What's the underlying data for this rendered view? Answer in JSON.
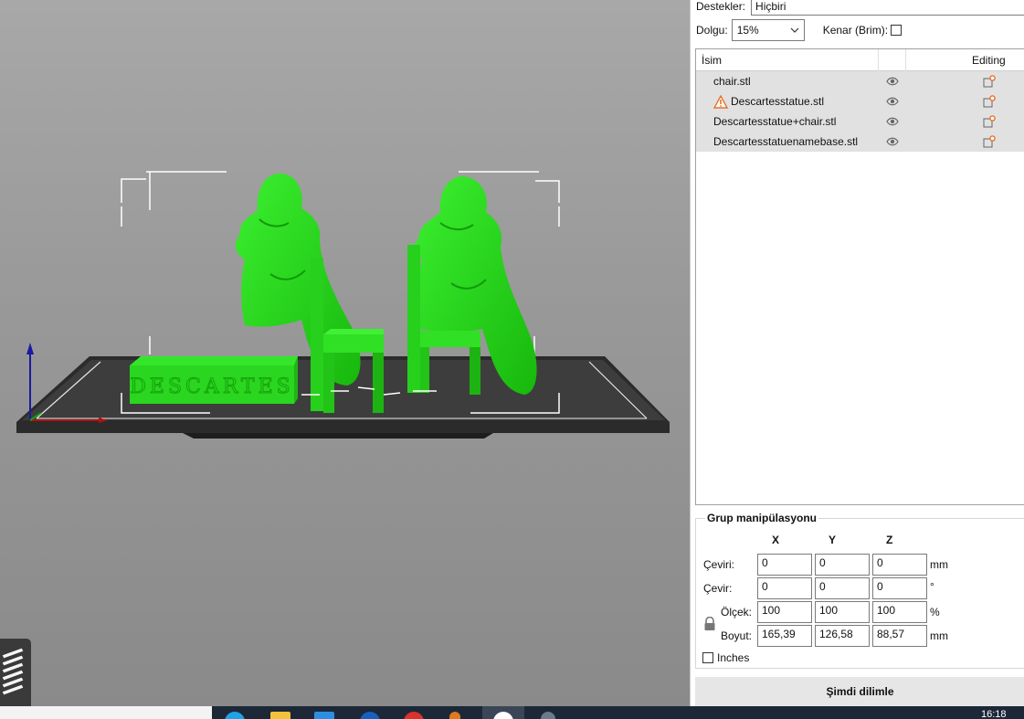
{
  "settings": {
    "supports_label": "Destekler:",
    "supports_value": "Hiçbiri",
    "infill_label": "Dolgu:",
    "infill_value": "15%",
    "brim_label": "Kenar (Brim):"
  },
  "object_list": {
    "col_name": "İsim",
    "col_editing": "Editing",
    "items": [
      {
        "name": "chair.stl",
        "warning": false
      },
      {
        "name": "Descartesstatue.stl",
        "warning": true
      },
      {
        "name": "Descartesstatue+chair.stl",
        "warning": false
      },
      {
        "name": "Descartesstatuenamebase.stl",
        "warning": false
      }
    ]
  },
  "manipulation": {
    "title": "Grup manipülasyonu",
    "axis_x": "X",
    "axis_y": "Y",
    "axis_z": "Z",
    "translate_label": "Çeviri:",
    "translate": [
      "0",
      "0",
      "0"
    ],
    "translate_unit": "mm",
    "rotate_label": "Çevir:",
    "rotate": [
      "0",
      "0",
      "0"
    ],
    "rotate_unit": "°",
    "scale_label": "Ölçek:",
    "scale": [
      "100",
      "100",
      "100"
    ],
    "scale_unit": "%",
    "size_label": "Boyut:",
    "size": [
      "165,39",
      "126,58",
      "88,57"
    ],
    "size_unit": "mm",
    "inches_label": "Inches"
  },
  "slice_button_label": "Şimdi dilimle",
  "scene_text": {
    "base_engraving": "DESCARTES"
  },
  "taskbar": {
    "clock": "16:18"
  },
  "colors": {
    "model_green": "#22dd11",
    "bed": "#3a3a3a",
    "warning_orange": "#e8702a",
    "edit_icon_orange": "#e8702a",
    "list_row_bg": "#e1e1e1"
  }
}
